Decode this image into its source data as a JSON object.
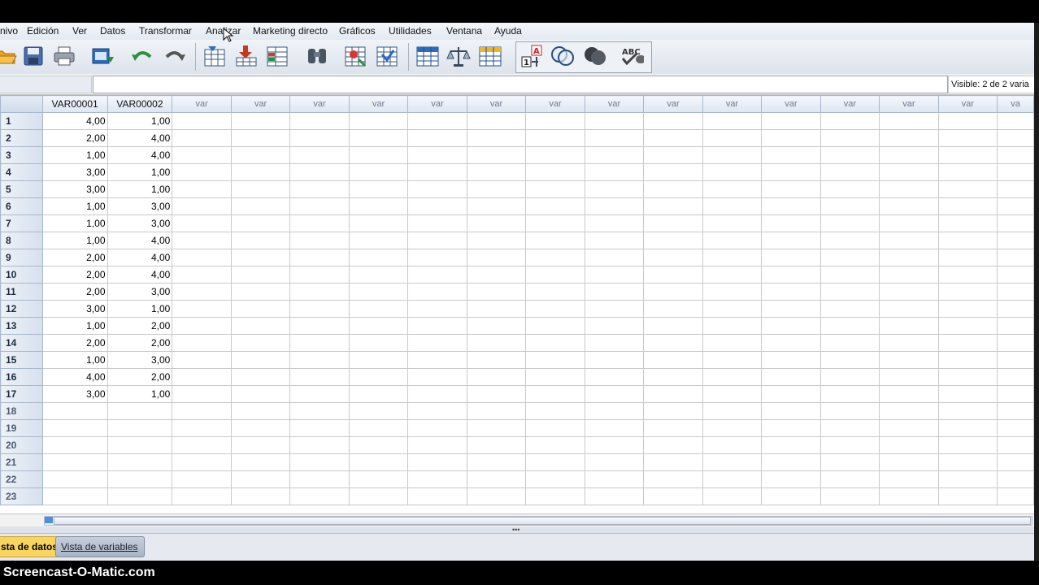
{
  "menu": [
    "nivo",
    "Edición",
    "Ver",
    "Datos",
    "Transformar",
    "Analizar",
    "Marketing directo",
    "Gráficos",
    "Utilidades",
    "Ventana",
    "Ayuda"
  ],
  "toolbar": {
    "icons": [
      "open-folder-icon",
      "save-icon",
      "print-icon",
      "dialog-recall-icon",
      "undo-icon",
      "redo-icon",
      "goto-case-icon",
      "goto-variable-icon",
      "variables-icon",
      "find-icon",
      "insert-cases-icon",
      "insert-variable-icon",
      "split-file-icon",
      "weight-cases-icon",
      "select-cases-icon",
      "value-labels-icon",
      "use-variable-sets-icon",
      "show-all-variables-icon",
      "spell-check-icon"
    ]
  },
  "formula": {
    "visible_text": "Visible: 2 de 2 varia"
  },
  "grid": {
    "columns": [
      "VAR00001",
      "VAR00002",
      "var",
      "var",
      "var",
      "var",
      "var",
      "var",
      "var",
      "var",
      "var",
      "var",
      "var",
      "var",
      "var",
      "var",
      "va"
    ],
    "row_numbers": [
      "1",
      "2",
      "3",
      "4",
      "5",
      "6",
      "7",
      "8",
      "9",
      "10",
      "11",
      "12",
      "13",
      "14",
      "15",
      "16",
      "17",
      "18",
      "19",
      "20",
      "21",
      "22",
      "23"
    ],
    "rows": [
      [
        "4,00",
        "1,00"
      ],
      [
        "2,00",
        "4,00"
      ],
      [
        "1,00",
        "4,00"
      ],
      [
        "3,00",
        "1,00"
      ],
      [
        "3,00",
        "1,00"
      ],
      [
        "1,00",
        "3,00"
      ],
      [
        "1,00",
        "3,00"
      ],
      [
        "1,00",
        "4,00"
      ],
      [
        "2,00",
        "4,00"
      ],
      [
        "2,00",
        "4,00"
      ],
      [
        "2,00",
        "3,00"
      ],
      [
        "3,00",
        "1,00"
      ],
      [
        "1,00",
        "2,00"
      ],
      [
        "2,00",
        "2,00"
      ],
      [
        "1,00",
        "3,00"
      ],
      [
        "4,00",
        "2,00"
      ],
      [
        "3,00",
        "1,00"
      ]
    ]
  },
  "tabs": {
    "data_view": "sta de datos",
    "variable_view": "Vista de variables"
  },
  "watermark": "Screencast-O-Matic.com"
}
